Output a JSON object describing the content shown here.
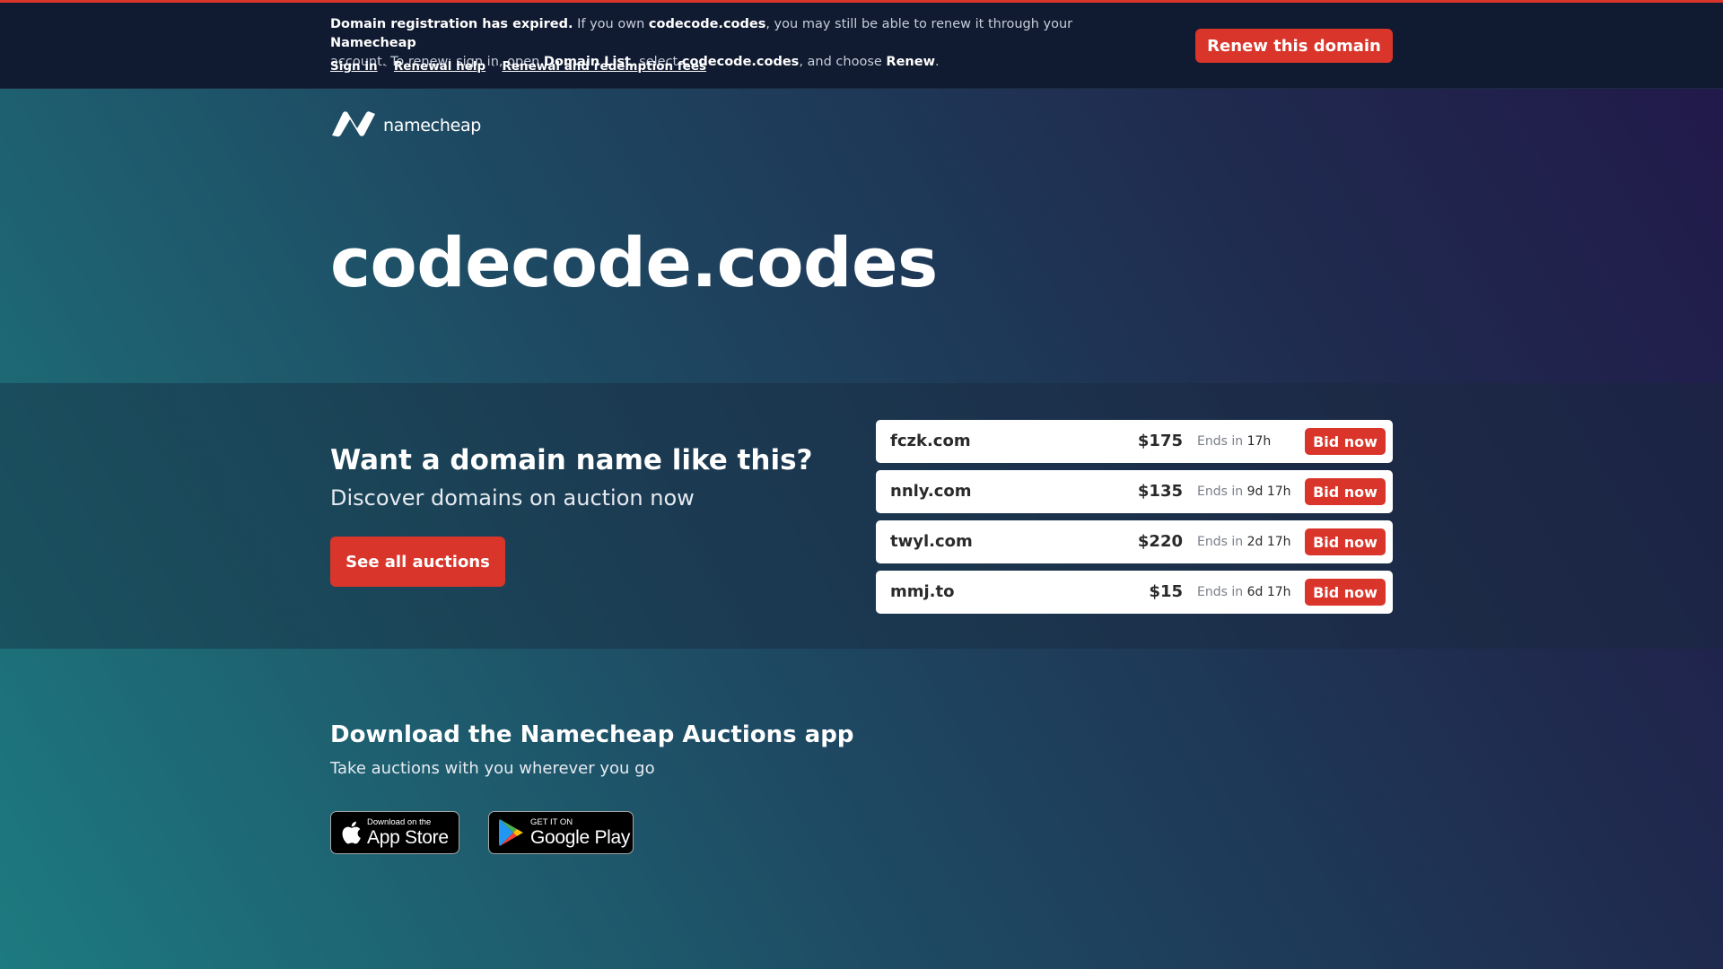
{
  "colors": {
    "accent": "#d9352a",
    "banner_bg": "#101a30",
    "text": "#ffffff"
  },
  "banner": {
    "expired_lead": "Domain registration has expired.",
    "text_1": " If you own ",
    "domain": "codecode.codes",
    "text_2": ", you may still be able to renew it through your ",
    "registrar": "Namecheap",
    "text_3": " account. To renew: sign in, open ",
    "domain_list": "Domain List",
    "text_4": ", select ",
    "text_5": ", and choose ",
    "renew_word": "Renew",
    "text_6": ".",
    "links": {
      "sign_in": "Sign in",
      "renewal_help": "Renewal help",
      "fees": "Renewal and redemption fees",
      "separator": "·"
    },
    "renew_button": "Renew this domain"
  },
  "logo": {
    "icon": "namecheap-n-icon",
    "wordmark": "namecheap"
  },
  "hero": {
    "domain_title": "codecode.codes"
  },
  "auctions": {
    "title": "Want a domain name like this?",
    "subtitle": "Discover domains on auction now",
    "see_all": "See all auctions",
    "items": [
      {
        "domain": "fczk.com",
        "price": "$175",
        "ends_label": "Ends in",
        "ends_time": "17h",
        "bid": "Bid now"
      },
      {
        "domain": "nnly.com",
        "price": "$135",
        "ends_label": "Ends in",
        "ends_time": "9d 17h",
        "bid": "Bid now"
      },
      {
        "domain": "twyl.com",
        "price": "$220",
        "ends_label": "Ends in",
        "ends_time": "2d 17h",
        "bid": "Bid now"
      },
      {
        "domain": "mmj.to",
        "price": "$15",
        "ends_label": "Ends in",
        "ends_time": "6d 17h",
        "bid": "Bid now"
      }
    ]
  },
  "app": {
    "title": "Download the Namecheap Auctions app",
    "subtitle": "Take auctions with you wherever you go",
    "app_store": {
      "small": "Download on the",
      "big": "App Store",
      "icon": "apple-icon"
    },
    "google_play": {
      "small": "GET IT ON",
      "big": "Google Play",
      "icon": "google-play-icon"
    }
  }
}
